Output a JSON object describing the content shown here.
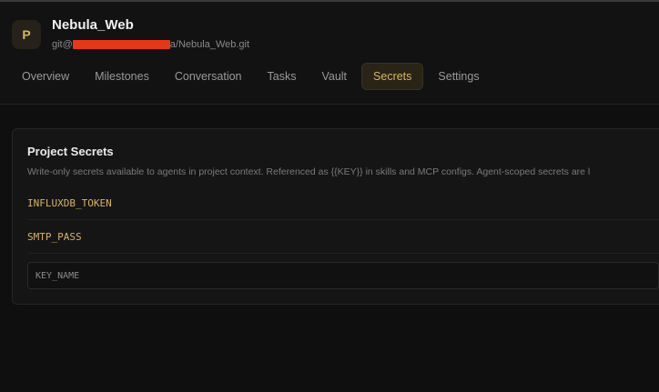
{
  "project": {
    "avatar_letter": "P",
    "name": "Nebula_Web",
    "repo_prefix": "git@",
    "repo_suffix": "a/Nebula_Web.git"
  },
  "tabs": [
    {
      "label": "Overview",
      "active": false
    },
    {
      "label": "Milestones",
      "active": false
    },
    {
      "label": "Conversation",
      "active": false
    },
    {
      "label": "Tasks",
      "active": false
    },
    {
      "label": "Vault",
      "active": false
    },
    {
      "label": "Secrets",
      "active": true
    },
    {
      "label": "Settings",
      "active": false
    }
  ],
  "secrets_card": {
    "title": "Project Secrets",
    "description": "Write-only secrets available to agents in project context. Referenced as {{KEY}} in skills and MCP configs. Agent-scoped secrets are l",
    "keys": [
      "INFLUXDB_TOKEN",
      "SMTP_PASS"
    ],
    "input_placeholder": "KEY_NAME"
  },
  "colors": {
    "accent": "#d9b45f",
    "redaction": "#e53818",
    "background": "#0f0f0f"
  }
}
